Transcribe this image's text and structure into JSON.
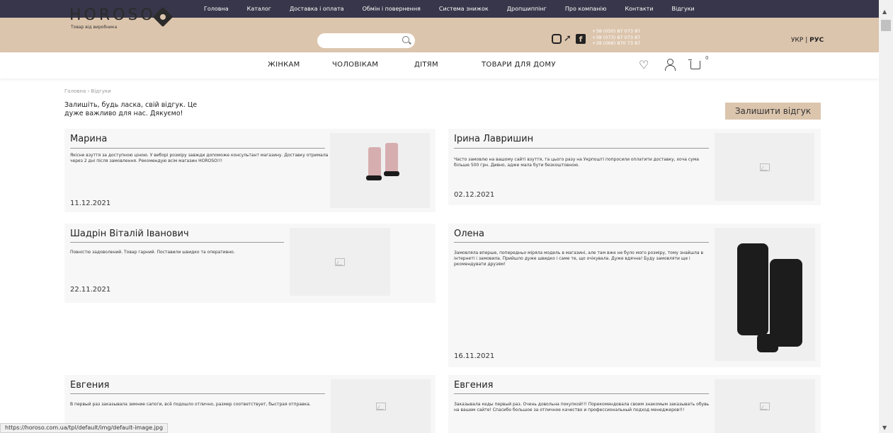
{
  "top_nav": [
    "Головна",
    "Каталог",
    "Доставка і оплата",
    "Обмін і повернення",
    "Система знижок",
    "Дропшиппінг",
    "Про компанію",
    "Контакти",
    "Відгуки"
  ],
  "header": {
    "logo": "HOROSO",
    "logo_sub": "Товар від виробника",
    "phones": [
      "+38 (050) 87 073 87",
      "+38 (073) 87 073 87",
      "+38 (068) 870 73 87"
    ],
    "lang_ukr": "УКР",
    "lang_sep": "|",
    "lang_rus": "РУС"
  },
  "cat_nav": [
    "ЖІНКАМ",
    "ЧОЛОВІКАМ",
    "ДІТЯМ",
    "ТОВАРИ ДЛЯ ДОМУ"
  ],
  "cart_count": "0",
  "breadcrumb": "Головна › Відгуки",
  "intro": "Залишіть, будь ласка, свій відгук. Це дуже важливо для нас. Дякуємо!",
  "leave_button": "Залишити відгук",
  "reviews": [
    {
      "name": "Марина",
      "text": "Якісне взуття за доступною ціною. У виборі розміру завжди допоможе консультант магазину. Доставку отримала через 2 дні після замовлення. Рекомендую всім магазин HOROSO!!!",
      "date": "11.12.2021"
    },
    {
      "name": "Ірина Лавришин",
      "text": "Часто замовлю на вашому сайті взуття, та цього разу на Укрпошті попросили оплатити доставку, хоча сума більше 500 грн. Дивно, адже мала бути безкоштовною.",
      "date": "02.12.2021"
    },
    {
      "name": "Шадрін Віталій Іванович",
      "text": "Повністю задоволений. Товар гарний. Поставили швидко та оперативно.",
      "date": "22.11.2021"
    },
    {
      "name": "Олена",
      "text": "Замовляла вперше, попередньо міряла модель в магазині, але там вже не було мого розміру, тому знайшла в інтернеті і замовила. Прийшло дуже швидко і саме те, що очікувала. Дуже вдячна! Буду замовляти ще і ркомендувати друзям!",
      "date": "16.11.2021"
    },
    {
      "name": "Евгения",
      "text": "В первый раз заказывала зимние сапоги, всё подошло отлично, размер соответствует, быстрая отправка.",
      "date": ""
    },
    {
      "name": "Евгения",
      "text": "Заказывала кеды первый раз. Очень довольна покупкой!!! Порекомендовала своим знакомым заказывать обувь на вашем сайте! Спасибо большое за отличное качество и профессиональный подход менеджеров!!!",
      "date": ""
    }
  ],
  "status_url": "https://horoso.com.ua/tpl/default/img/default-image.jpg"
}
